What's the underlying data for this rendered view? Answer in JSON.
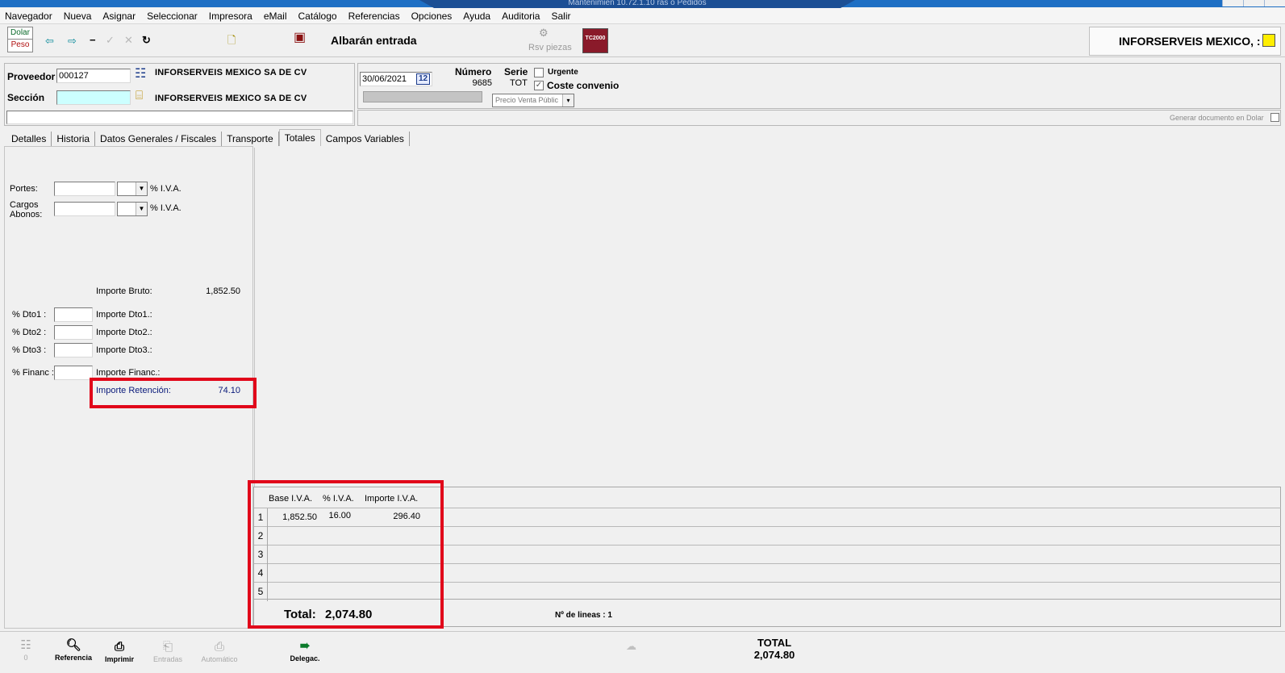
{
  "window": {
    "title": "Mantenimien 10.72.1.10 ras o Pedidos"
  },
  "menu": [
    "Navegador",
    "Nueva",
    "Asignar",
    "Seleccionar",
    "Impresora",
    "eMail",
    "Catálogo",
    "Referencias",
    "Opciones",
    "Ayuda",
    "Auditoria",
    "Salir"
  ],
  "toolbar": {
    "currency_top": "Dolar",
    "currency_bottom": "Peso",
    "document_title": "Albarán entrada",
    "rsv_label": "Rsv piezas",
    "tc_label": "TC2000"
  },
  "company": {
    "name": "INFORSERVEIS MEXICO, :",
    "indicator_color": "#ffee00"
  },
  "header": {
    "proveedor_label": "Proveedor",
    "proveedor_code": "000127",
    "proveedor_name": "INFORSERVEIS MEXICO SA DE CV",
    "seccion_label": "Sección",
    "seccion_value": "",
    "seccion_name": "INFORSERVEIS MEXICO SA DE CV",
    "date": "30/06/2021",
    "cal_label": "12",
    "numero_label": "Número",
    "numero_value": "9685",
    "serie_label": "Serie",
    "serie_value": "TOT",
    "urgente_label": "Urgente",
    "coste_label": "Coste convenio",
    "precio_select": "Precio Venta Públic",
    "generar_label": "Generar documento en Dolar"
  },
  "tabs": [
    "Detalles",
    "Historia",
    "Datos Generales / Fiscales",
    "Transporte",
    "Totales",
    "Campos Variables"
  ],
  "active_tab": "Totales",
  "totales": {
    "portes_label": "Portes:",
    "iva_label": "% I.V.A.",
    "cargos_label": "Cargos\nAbonos:",
    "importe_bruto_label": "Importe Bruto:",
    "importe_bruto_value": "1,852.50",
    "dto1_label": "% Dto1 :",
    "dto2_label": "% Dto2 :",
    "dto3_label": "% Dto3 :",
    "financ_label": "% Financ :",
    "importe_dto1_label": "Importe Dto1.:",
    "importe_dto2_label": "Importe Dto2.:",
    "importe_dto3_label": "Importe Dto3.:",
    "importe_financ_label": "Importe Financ.:",
    "retencion_label": "Importe  Retención:",
    "retencion_value": "74.10"
  },
  "iva_grid": {
    "headers": [
      "Base I.V.A.",
      "% I.V.A.",
      "Importe I.V.A."
    ],
    "rows": [
      {
        "n": "1",
        "base": "1,852.50",
        "pct": "16.00",
        "importe": "296.40"
      },
      {
        "n": "2",
        "base": "",
        "pct": "",
        "importe": ""
      },
      {
        "n": "3",
        "base": "",
        "pct": "",
        "importe": ""
      },
      {
        "n": "4",
        "base": "",
        "pct": "",
        "importe": ""
      },
      {
        "n": "5",
        "base": "",
        "pct": "",
        "importe": ""
      }
    ],
    "total_label": "Total:",
    "total_value": "2,074.80",
    "lineas_label": "Nº de lineas : 1"
  },
  "bottom": {
    "btn0": "0",
    "referencia": "Referencia",
    "imprimir": "Imprimir",
    "entradas": "Entradas",
    "automatico": "Automático",
    "delegac": "Delegac.",
    "total_label": "TOTAL",
    "total_value": "2,074.80"
  },
  "highlight_color": "#e1061a"
}
